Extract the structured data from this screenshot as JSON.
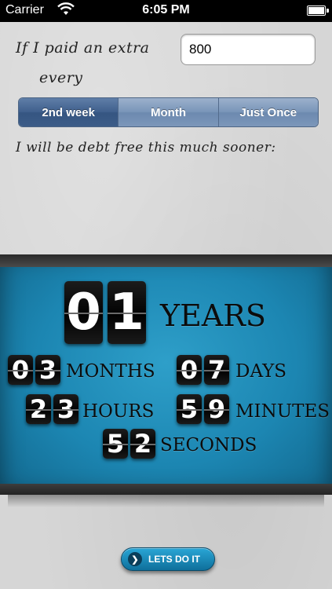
{
  "status_bar": {
    "carrier": "Carrier",
    "time": "6:05 PM",
    "icons": [
      "wifi-icon",
      "battery-icon"
    ]
  },
  "form": {
    "prompt_line1": "If I paid an extra",
    "amount_value": "800",
    "prompt_line2": "every",
    "frequency_options": [
      "2nd week",
      "Month",
      "Just Once"
    ],
    "selected_option": "2nd week",
    "result_label": "I will be debt free this much sooner:"
  },
  "countdown": {
    "years": {
      "digits": [
        "0",
        "1"
      ],
      "label": "YEARS"
    },
    "months": {
      "digits": [
        "0",
        "3"
      ],
      "label": "MONTHS"
    },
    "days": {
      "digits": [
        "0",
        "7"
      ],
      "label": "DAYS"
    },
    "hours": {
      "digits": [
        "2",
        "3"
      ],
      "label": "HOURS"
    },
    "minutes": {
      "digits": [
        "5",
        "9"
      ],
      "label": "MINUTES"
    },
    "seconds": {
      "digits": [
        "5",
        "2"
      ],
      "label": "SECONDS"
    }
  },
  "action": {
    "button_label": "LETS DO IT",
    "icon": "chevron-right-icon"
  },
  "colors": {
    "panel_blue": "#1c86b2",
    "segment_selected": "#3f5f8c",
    "segment_normal": "#7894b8",
    "button_blue": "#1a8fc0"
  }
}
